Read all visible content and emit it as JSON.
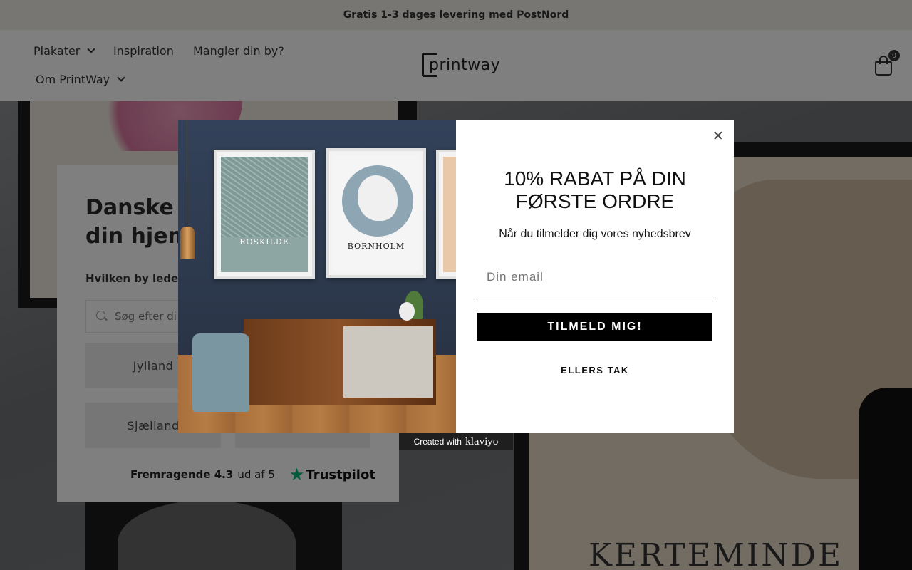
{
  "announcement": "Gratis 1-3 dages levering med PostNord",
  "nav": {
    "items": [
      {
        "label": "Plakater",
        "has_dropdown": true
      },
      {
        "label": "Inspiration",
        "has_dropdown": false
      },
      {
        "label": "Mangler din by?",
        "has_dropdown": false
      },
      {
        "label": "Om PrintWay",
        "has_dropdown": true
      }
    ],
    "logo_text": "printway",
    "cart_count": "0"
  },
  "hero": {
    "title_line1": "Danske p",
    "title_line2": "din hjem",
    "question": "Hvilken by leder d",
    "search_placeholder": "Søg efter di",
    "regions": [
      "Jylland",
      "Sjælland"
    ],
    "trustpilot": {
      "rating_label": "Fremragende 4.3",
      "rating_suffix": "ud af 5",
      "brand": "Trustpilot"
    },
    "background_city": "KERTEMINDE"
  },
  "modal": {
    "posters": [
      "ROSKILDE",
      "BORNHOLM"
    ],
    "title": "10% RABAT PÅ DIN FØRSTE ORDRE",
    "subtitle": "Når du tilmelder dig vores nyhedsbrev",
    "email_placeholder": "Din email",
    "submit_label": "TILMELD MIG!",
    "decline_label": "ELLERS TAK",
    "close_icon": "close-icon"
  },
  "badge": {
    "prefix": "Created with",
    "brand": "klaviyo"
  },
  "colors": {
    "announcement_bg": "#f1ece4",
    "submit_bg": "#000000",
    "trustpilot_green": "#00b67a",
    "overlay": "rgba(0,0,0,0.5)"
  }
}
